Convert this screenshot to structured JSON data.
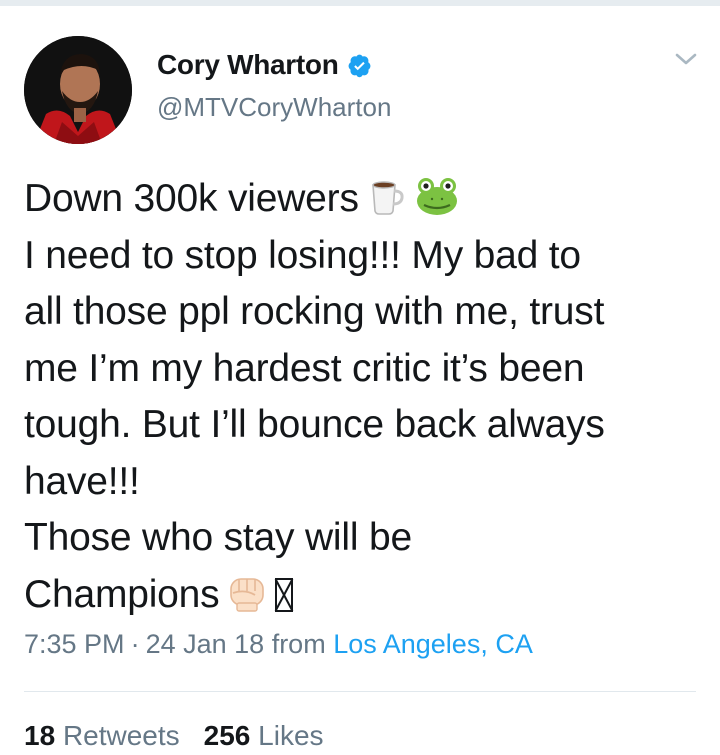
{
  "tweet": {
    "display_name": "Cory Wharton",
    "handle": "@MTVCoryWharton",
    "verified": true,
    "text_lines": [
      "Down 300k viewers",
      "I need to stop losing!!! My bad to",
      "all those ppl rocking with me, trust",
      "me I’m my hardest critic it’s been",
      "tough. But I’ll bounce back always",
      "have!!!",
      "Those who stay will be",
      "Champions"
    ],
    "emojis": [
      "coffee-cup-icon",
      "frog-icon",
      "raised-fist-icon"
    ],
    "time": "7:35 PM",
    "date": "24 Jan 18",
    "from_label": "from",
    "location": "Los Angeles, CA",
    "retweets_count": "18",
    "retweets_label": "Retweets",
    "likes_count": "256",
    "likes_label": "Likes"
  },
  "colors": {
    "text": "#14171a",
    "secondary": "#657786",
    "link": "#1da1f2",
    "verified": "#1da1f2",
    "divider": "#e1e8ed"
  }
}
